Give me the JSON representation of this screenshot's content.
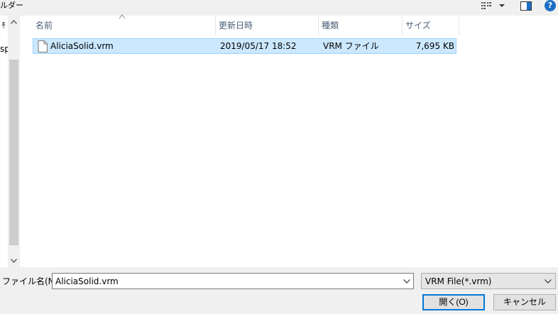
{
  "topbar": {
    "breadcrumb": "ルダー",
    "help_label": "?"
  },
  "sidebar": {
    "partial_text": "sp"
  },
  "columns": {
    "name": "名前",
    "date": "更新日時",
    "type": "種類",
    "size": "サイズ"
  },
  "files": [
    {
      "name": "AliciaSolid.vrm",
      "date": "2019/05/17 18:52",
      "type": "VRM ファイル",
      "size": "7,695 KB"
    }
  ],
  "bottom": {
    "filename_label": "ファイル名(N):",
    "filename_value": "AliciaSolid.vrm",
    "filetype_value": "VRM File(*.vrm)",
    "open_label": "開く(O)",
    "cancel_label": "キャンセル"
  },
  "colors": {
    "selection_bg": "#cce8ff",
    "selection_border": "#99d1ff",
    "header_text": "#4c607a",
    "accent": "#0078d7"
  }
}
